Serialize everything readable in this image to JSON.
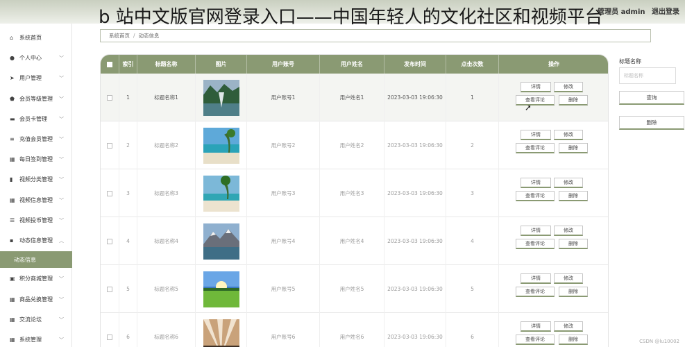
{
  "overlay_title": "b 站中文版官网登录入口——中国年轻人的文化社区和视频平台",
  "header": {
    "admin_label": "管理员 admin",
    "logout": "退出登录"
  },
  "sidebar": {
    "items": [
      {
        "label": "系统首页",
        "icon": "home-icon"
      },
      {
        "label": "个人中心",
        "icon": "user-icon"
      },
      {
        "label": "用户管理",
        "icon": "send-icon"
      },
      {
        "label": "会员等级管理",
        "icon": "shield-icon"
      },
      {
        "label": "会员卡管理",
        "icon": "card-icon"
      },
      {
        "label": "充值会员管理",
        "icon": "list-icon"
      },
      {
        "label": "每日签到管理",
        "icon": "grid-icon"
      },
      {
        "label": "视频分类管理",
        "icon": "chart-icon"
      },
      {
        "label": "视频信息管理",
        "icon": "grid-icon"
      },
      {
        "label": "视频投币管理",
        "icon": "sliders-icon"
      },
      {
        "label": "动态信息管理",
        "icon": "message-icon"
      },
      {
        "label": "积分商城管理",
        "icon": "box-icon"
      },
      {
        "label": "商品兑换管理",
        "icon": "grid-icon"
      },
      {
        "label": "交流论坛",
        "icon": "grid-icon"
      },
      {
        "label": "系统管理",
        "icon": "grid-icon"
      }
    ],
    "active_sub": "动态信息"
  },
  "breadcrumb": {
    "home": "系统首页",
    "current": "动态信息"
  },
  "table": {
    "headers": [
      "",
      "索引",
      "标题名称",
      "图片",
      "用户账号",
      "用户姓名",
      "发布时间",
      "点击次数",
      "操作"
    ],
    "rows": [
      {
        "index": "1",
        "title": "标题名称1",
        "account": "用户账号1",
        "name": "用户姓名1",
        "time": "2023-03-03 19:06:30",
        "clicks": "1"
      },
      {
        "index": "2",
        "title": "标题名称2",
        "account": "用户账号2",
        "name": "用户姓名2",
        "time": "2023-03-03 19:06:30",
        "clicks": "2"
      },
      {
        "index": "3",
        "title": "标题名称3",
        "account": "用户账号3",
        "name": "用户姓名3",
        "time": "2023-03-03 19:06:30",
        "clicks": "3"
      },
      {
        "index": "4",
        "title": "标题名称4",
        "account": "用户账号4",
        "name": "用户姓名4",
        "time": "2023-03-03 19:06:30",
        "clicks": "4"
      },
      {
        "index": "5",
        "title": "标题名称5",
        "account": "用户账号5",
        "name": "用户姓名5",
        "time": "2023-03-03 19:06:30",
        "clicks": "5"
      },
      {
        "index": "6",
        "title": "标题名称6",
        "account": "用户账号6",
        "name": "用户姓名6",
        "time": "2023-03-03 19:06:30",
        "clicks": "6"
      }
    ],
    "actions": {
      "detail": "详情",
      "edit": "修改",
      "comments": "查看评论",
      "delete": "删除"
    }
  },
  "search_panel": {
    "label": "标题名称",
    "placeholder": "标题名称",
    "search_button": "查询",
    "delete_button": "删除"
  },
  "watermark": "CSDN @lu10002",
  "colors": {
    "accent": "#8a9a73"
  }
}
